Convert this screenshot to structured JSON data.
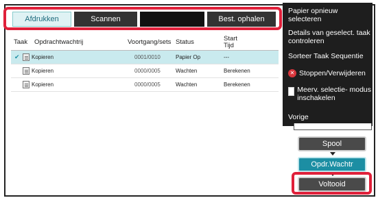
{
  "tabs": [
    {
      "label": "Afdrukken",
      "active": true
    },
    {
      "label": "Scannen",
      "active": false
    },
    {
      "label": "",
      "active": false
    },
    {
      "label": "Best. ophalen",
      "active": false
    }
  ],
  "table": {
    "headers": [
      "Taak",
      "Opdrachtwachtrij",
      "Voortgang/sets",
      "Status",
      "Start\nTijd"
    ],
    "header_start": "Start",
    "header_tijd": "Tijd",
    "rows": [
      {
        "queue": "Kopieren",
        "progress": "0001/0010",
        "status": "Papier Op",
        "start": "---",
        "selected": true
      },
      {
        "queue": "Kopieren",
        "progress": "0000/0005",
        "status": "Wachten",
        "start": "Berekenen",
        "selected": false
      },
      {
        "queue": "Kopieren",
        "progress": "0000/0005",
        "status": "Wachten",
        "start": "Berekenen",
        "selected": false
      }
    ]
  },
  "menu": {
    "item1": "Papier opnieuw selecteren",
    "item2": "Details van geselect. taak controleren",
    "item3": "Sorteer Taak Sequentie",
    "item4": "Stoppen/Verwijderen",
    "item5": "Meerv. selectie- modus inschakelen",
    "item6": "Vorige"
  },
  "buttons": {
    "spool": "Spool",
    "opdr": "Opdr.Wachtr",
    "voltooid": "Voltooid"
  },
  "colors": {
    "highlight": "#e0203a",
    "accent": "#1c8ea3",
    "panel": "#1e1e1e"
  }
}
